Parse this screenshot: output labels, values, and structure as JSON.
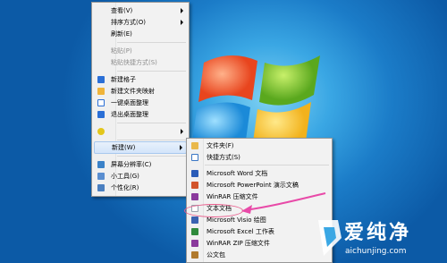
{
  "context_menu": {
    "items": [
      {
        "label": "查看(V)",
        "submenu": true
      },
      {
        "label": "排序方式(O)",
        "submenu": true
      },
      {
        "label": "刷新(E)"
      },
      {
        "label": "粘贴(P)",
        "disabled": true
      },
      {
        "label": "粘贴快捷方式(S)",
        "disabled": true
      },
      {
        "label": "新建格子",
        "icon": "fences-icon"
      },
      {
        "label": "新建文件夹映射",
        "icon": "folder-map-icon"
      },
      {
        "label": "一键桌面整理",
        "icon": "desktop-organize-icon"
      },
      {
        "label": "退出桌面整理",
        "icon": "exit-organize-icon"
      },
      {
        "label": "",
        "icon": "graphics-icon",
        "submenu": true
      },
      {
        "label": "新建(W)",
        "submenu": true,
        "highlighted": true
      },
      {
        "label": "屏幕分辨率(C)",
        "icon": "screen-resolution-icon"
      },
      {
        "label": "小工具(G)",
        "icon": "gadgets-icon"
      },
      {
        "label": "个性化(R)",
        "icon": "personalize-icon"
      }
    ]
  },
  "new_submenu": {
    "items": [
      {
        "label": "文件夹(F)",
        "icon": "folder-icon"
      },
      {
        "label": "快捷方式(S)",
        "icon": "shortcut-icon"
      },
      {
        "label": "Microsoft Word 文档",
        "icon": "word-icon"
      },
      {
        "label": "Microsoft PowerPoint 演示文稿",
        "icon": "powerpoint-icon"
      },
      {
        "label": "WinRAR 压缩文件",
        "icon": "winrar-icon"
      },
      {
        "label": "文本文档",
        "icon": "text-document-icon"
      },
      {
        "label": "Microsoft Visio 绘图",
        "icon": "visio-icon"
      },
      {
        "label": "Microsoft Excel 工作表",
        "icon": "excel-icon"
      },
      {
        "label": "WinRAR ZIP 压缩文件",
        "icon": "winrar-zip-icon"
      },
      {
        "label": "公文包",
        "icon": "briefcase-icon"
      }
    ]
  },
  "watermark": {
    "title": "爱纯净",
    "url": "aichunjing.com"
  },
  "colors": {
    "menu_bg": "#f2f2f2",
    "highlight": "#d3e5fa",
    "annotation": "#e85a8a"
  }
}
